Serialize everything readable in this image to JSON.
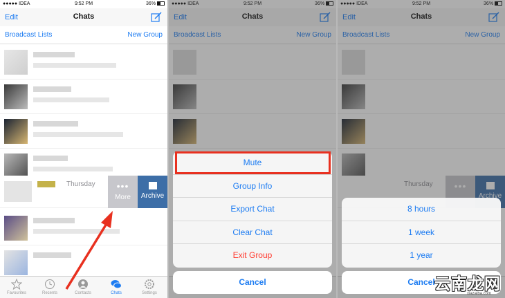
{
  "status": {
    "carrier": "●●●●● IDEA",
    "time": "9:52 PM",
    "battery": "36%"
  },
  "nav": {
    "edit": "Edit",
    "title": "Chats"
  },
  "subnav": {
    "broadcast": "Broadcast Lists",
    "new_group": "New Group"
  },
  "swipe": {
    "day": "Thursday",
    "more": "More",
    "archive": "Archive"
  },
  "tabs": [
    {
      "label": "Favourites",
      "icon": "star-icon"
    },
    {
      "label": "Recents",
      "icon": "clock-icon"
    },
    {
      "label": "Contacts",
      "icon": "person-icon"
    },
    {
      "label": "Chats",
      "icon": "chat-bubbles-icon"
    },
    {
      "label": "Settings",
      "icon": "gear-icon"
    }
  ],
  "sheet_more": {
    "options": [
      "Mute",
      "Group Info",
      "Export Chat",
      "Clear Chat",
      "Exit Group"
    ],
    "cancel": "Cancel"
  },
  "sheet_mute": {
    "options": [
      "8 hours",
      "1 week",
      "1 year"
    ],
    "cancel": "Cancel"
  },
  "watermark": {
    "text": "云南龙网",
    "url": "xiazaiba.com"
  },
  "colors": {
    "accent": "#1d7cf2",
    "danger": "#ff3b30",
    "archive": "#3d6ea7",
    "highlight": "#e8301f"
  }
}
